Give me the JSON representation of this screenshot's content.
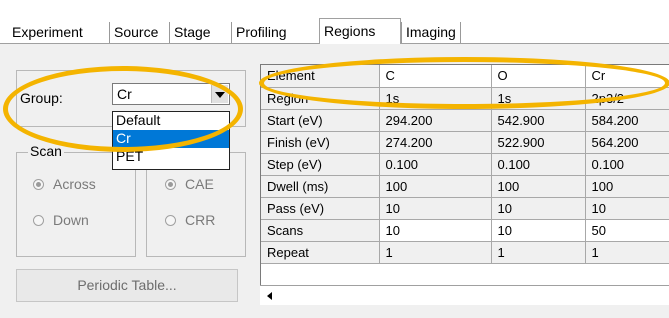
{
  "tabs": [
    {
      "label": "Experiment",
      "active": false
    },
    {
      "label": "Source",
      "active": false
    },
    {
      "label": "Stage",
      "active": false
    },
    {
      "label": "Profiling",
      "active": false
    },
    {
      "label": "Regions",
      "active": true
    },
    {
      "label": "Imaging",
      "active": false
    }
  ],
  "group": {
    "label": "Group:",
    "selected": "Cr",
    "options": [
      "Default",
      "Cr",
      "PET"
    ],
    "highlighted_option": "Cr"
  },
  "scan": {
    "label": "Scan",
    "options": [
      {
        "label": "Across",
        "checked": true
      },
      {
        "label": "Down",
        "checked": false
      }
    ]
  },
  "mode": {
    "options": [
      {
        "label": "CAE",
        "checked": true
      },
      {
        "label": "CRR",
        "checked": false
      }
    ]
  },
  "periodic_button": {
    "label": "Periodic Table..."
  },
  "table": {
    "rows": [
      {
        "label": "Element",
        "values": [
          "C",
          "O",
          "Cr"
        ]
      },
      {
        "label": "Region",
        "values": [
          "1s",
          "1s",
          "2p3/2"
        ]
      },
      {
        "label": "Start (eV)",
        "values": [
          "294.200",
          "542.900",
          "584.200"
        ]
      },
      {
        "label": "Finish (eV)",
        "values": [
          "274.200",
          "522.900",
          "564.200"
        ]
      },
      {
        "label": "Step (eV)",
        "values": [
          "0.100",
          "0.100",
          "0.100"
        ]
      },
      {
        "label": "Dwell (ms)",
        "values": [
          "100",
          "100",
          "100"
        ]
      },
      {
        "label": "Pass (eV)",
        "values": [
          "10",
          "10",
          "10"
        ]
      },
      {
        "label": "Scans",
        "values": [
          "10",
          "10",
          "50"
        ]
      },
      {
        "label": "Repeat",
        "values": [
          "1",
          "1",
          "1"
        ]
      }
    ]
  },
  "annotation_color": "#f4b400",
  "icons": {
    "dropdown": "chevron-down-icon",
    "scroll_left": "arrow-left-icon"
  }
}
